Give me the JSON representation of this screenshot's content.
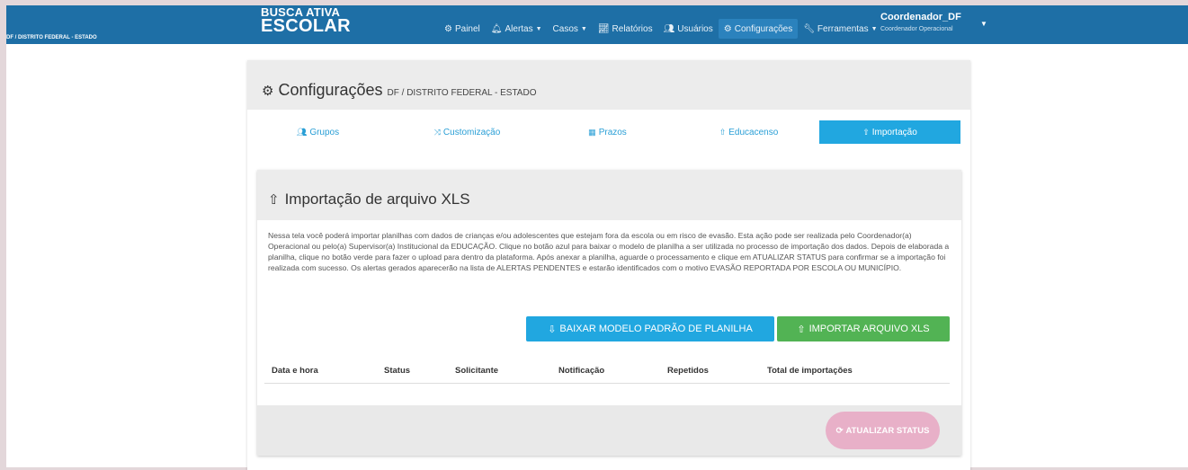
{
  "navbar": {
    "brand_line1": "BUSCA ATIVA",
    "brand_line2": "ESCOLAR",
    "brand_line3": "DF / DISTRITO FEDERAL - ESTADO",
    "items": [
      {
        "label": "Painel",
        "icon": "dashboard-icon"
      },
      {
        "label": "Alertas",
        "icon": "bell-icon",
        "dropdown": true
      },
      {
        "label": "Casos",
        "dropdown": true
      },
      {
        "label": "Relatórios",
        "icon": "chart-icon"
      },
      {
        "label": "Usuários",
        "icon": "users-icon"
      },
      {
        "label": "Configurações",
        "icon": "gear-icon",
        "active": true
      },
      {
        "label": "Ferramentas",
        "icon": "wrench-icon",
        "dropdown": true
      }
    ],
    "user_name": "Coordenador_DF",
    "user_role": "Coordenador Operacional",
    "color": "#1e6fa6"
  },
  "page": {
    "title": "Configurações",
    "subtitle": "DF / DISTRITO FEDERAL - ESTADO"
  },
  "tabs": [
    {
      "label": "Grupos",
      "icon": "users-icon"
    },
    {
      "label": "Customização",
      "icon": "shuffle-icon"
    },
    {
      "label": "Prazos",
      "icon": "calendar-icon"
    },
    {
      "label": "Educacenso",
      "icon": "upload-icon"
    },
    {
      "label": "Importação",
      "icon": "upload-icon",
      "active": true
    }
  ],
  "import": {
    "title": "Importação de arquivo XLS",
    "description": "Nessa tela você poderá importar planilhas com dados de crianças e/ou adolescentes que estejam fora da escola ou em risco de evasão. Esta ação pode ser realizada pelo Coordenador(a) Operacional ou pelo(a) Supervisor(a) Institucional da EDUCAÇÃO. Clique no botão azul para baixar o modelo de planilha a ser utilizada no processo de importação dos dados. Depois de elaborada a planilha, clique no botão verde para fazer o upload para dentro da plataforma. Após anexar a planilha, aguarde o processamento e clique em ATUALIZAR STATUS para confirmar se a importação foi realizada com sucesso. Os alertas gerados aparecerão na lista de ALERTAS PENDENTES e estarão identificados com o motivo EVASÃO REPORTADA POR ESCOLA OU MUNICÍPIO.",
    "download_button": "BAIXAR MODELO PADRÃO DE PLANILHA",
    "import_button": "IMPORTAR ARQUIVO XLS",
    "refresh_button": "ATUALIZAR STATUS",
    "columns": [
      "Data e hora",
      "Status",
      "Solicitante",
      "Notificação",
      "Repetidos",
      "Total de importações"
    ]
  },
  "colors": {
    "accent_blue": "#21a7e0",
    "green": "#52b354",
    "pink": "#e8b0c8"
  }
}
